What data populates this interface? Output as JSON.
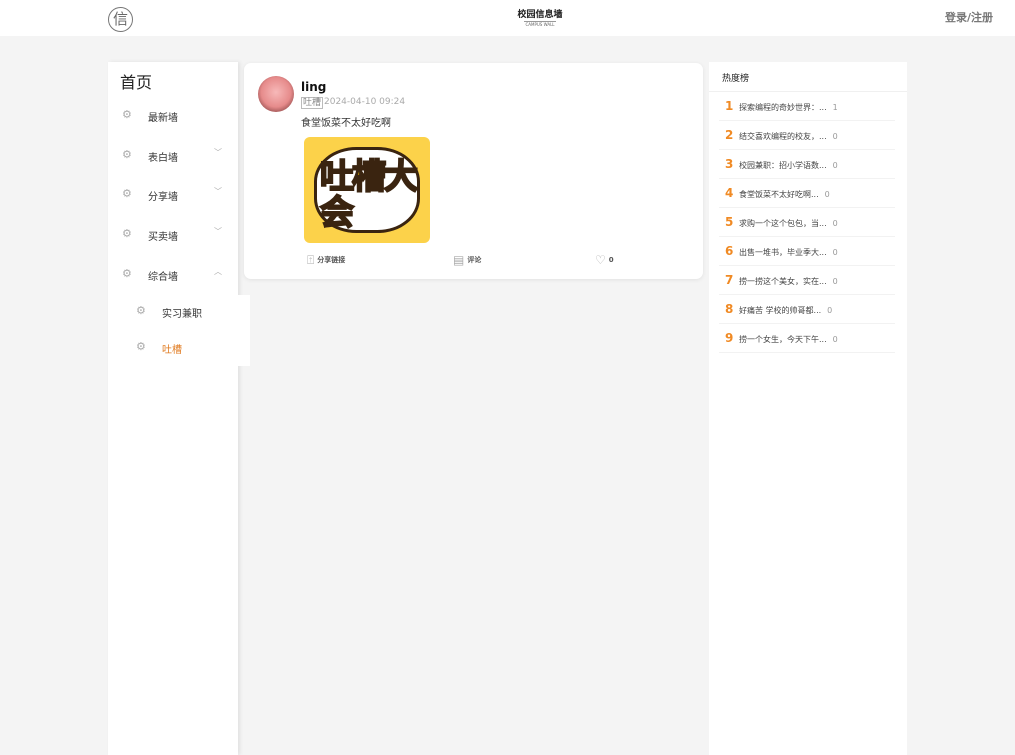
{
  "header": {
    "logo_char": "信",
    "brand_title": "校园信息墙",
    "brand_subtitle": "CAMPUS WALL",
    "login": "登录/注册"
  },
  "sidebar": {
    "home": "首页",
    "items": [
      {
        "label": "最新墙",
        "icon": "gear-icon",
        "expandable": false
      },
      {
        "label": "表白墙",
        "icon": "gear-icon",
        "expandable": true,
        "chevron": "﹀"
      },
      {
        "label": "分享墙",
        "icon": "gear-icon",
        "expandable": true,
        "chevron": "﹀"
      },
      {
        "label": "买卖墙",
        "icon": "gear-icon",
        "expandable": true,
        "chevron": "﹀"
      },
      {
        "label": "综合墙",
        "icon": "gear-icon",
        "expandable": true,
        "chevron": "︿"
      }
    ],
    "subitems": [
      {
        "label": "实习兼职"
      },
      {
        "label": "吐槽",
        "active": true
      }
    ]
  },
  "post": {
    "username": "ling",
    "tag": "吐槽",
    "time": "2024-04-10 09:24",
    "content": "食堂饭菜不太好吃啊",
    "image_text": "吐槽大会",
    "share": "分享链接",
    "comment": "评论",
    "likes": "0"
  },
  "hot": {
    "title": "热度榜",
    "items": [
      {
        "rank": "1",
        "title": "探索编程的奇妙世界：...",
        "count": "1"
      },
      {
        "rank": "2",
        "title": "结交喜欢编程的校友，...",
        "count": "0"
      },
      {
        "rank": "3",
        "title": "校园兼职：招小学语数...",
        "count": "0"
      },
      {
        "rank": "4",
        "title": "食堂饭菜不太好吃啊...",
        "count": "0"
      },
      {
        "rank": "5",
        "title": "求购一个这个包包，当...",
        "count": "0"
      },
      {
        "rank": "6",
        "title": "出售一堆书，毕业季大...",
        "count": "0"
      },
      {
        "rank": "7",
        "title": "捞一捞这个美女，实在...",
        "count": "0"
      },
      {
        "rank": "8",
        "title": "好痛苦 学校的帅哥都...",
        "count": "0"
      },
      {
        "rank": "9",
        "title": "捞一个女生，今天下午...",
        "count": "0"
      }
    ]
  },
  "colors": {
    "accent": "#f08a24",
    "active": "#e07a1f"
  }
}
